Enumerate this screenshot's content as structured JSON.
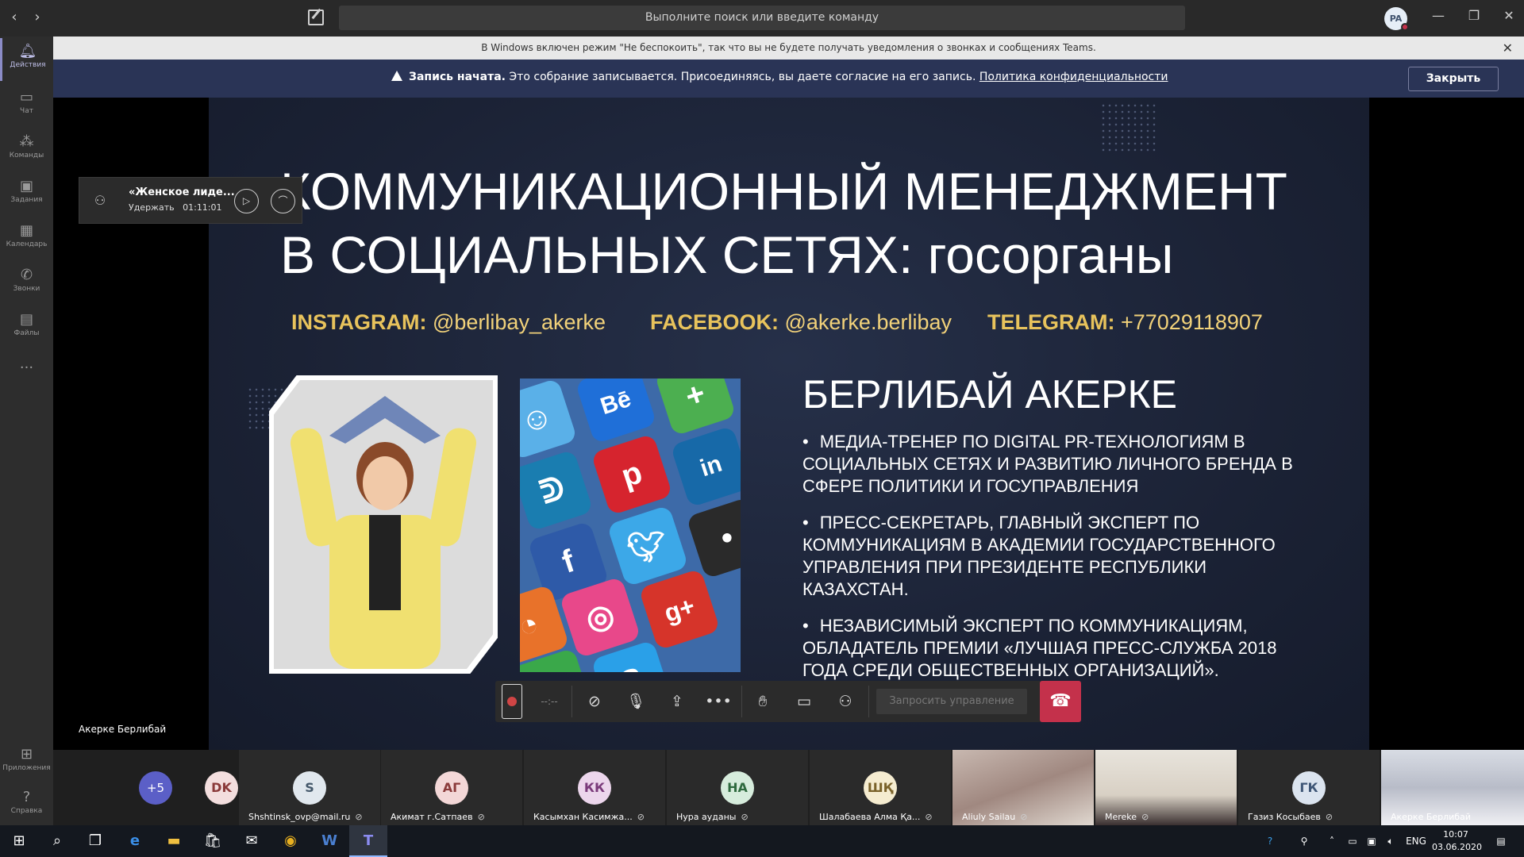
{
  "titlebar": {
    "search_placeholder": "Выполните поиск или введите команду",
    "user_initials": "PA"
  },
  "rail": {
    "items": [
      {
        "label": "Действия",
        "icon": "bell-icon"
      },
      {
        "label": "Чат",
        "icon": "chat-icon"
      },
      {
        "label": "Команды",
        "icon": "teams-icon"
      },
      {
        "label": "Задания",
        "icon": "assignments-icon"
      },
      {
        "label": "Календарь",
        "icon": "calendar-icon"
      },
      {
        "label": "Звонки",
        "icon": "phone-icon"
      },
      {
        "label": "Файлы",
        "icon": "file-icon"
      },
      {
        "label": "...",
        "icon": "more-icon"
      },
      {
        "label": "Приложения",
        "icon": "apps-icon"
      },
      {
        "label": "Справка",
        "icon": "help-icon"
      }
    ]
  },
  "notifications": {
    "dnd_text": "В Windows включен режим \"Не беспокоить\", так что вы не будете получать уведомления о звонках и сообщениях Teams.",
    "recording_bold": "Запись начата.",
    "recording_text": " Это собрание записывается. Присоединяясь, вы даете согласие на его запись. ",
    "privacy_link": "Политика конфиденциальности",
    "close_label": "Закрыть"
  },
  "held_call": {
    "title": "«Женское лиде...",
    "status": "Удержать",
    "duration": "01:11:01"
  },
  "slide": {
    "title_line1": "КОММУНИКАЦИОННЫЙ МЕНЕДЖМЕНТ",
    "title_line2": "В СОЦИАЛЬНЫХ СЕТЯХ: госорганы",
    "instagram_label": "INSTAGRAM:",
    "instagram_value": " @berlibay_akerke",
    "facebook_label": "FACEBOOK:",
    "facebook_value": " @akerke.berlibay",
    "telegram_label": "TELEGRAM:",
    "telegram_value": " +77029118907",
    "speaker_name": "БЕРЛИБАЙ АКЕРКЕ",
    "bullets": [
      "МЕДИА-ТРЕНЕР ПО DIGITAL PR-ТЕХНОЛОГИЯМ В СОЦИАЛЬНЫХ СЕТЯХ И РАЗВИТИЮ ЛИЧНОГО БРЕНДА В СФЕРЕ ПОЛИТИКИ И ГОСУПРАВЛЕНИЯ",
      "ПРЕСС-СЕКРЕТАРЬ, ГЛАВНЫЙ ЭКСПЕРТ ПО КОММУНИКАЦИЯМ В АКАДЕМИИ ГОСУДАРСТВЕННОГО УПРАВЛЕНИЯ ПРИ ПРЕЗИДЕНТЕ РЕСПУБЛИКИ КАЗАХСТАН.",
      "НЕЗАВИСИМЫЙ ЭКСПЕРТ ПО КОММУНИКАЦИЯМ, ОБЛАДАТЕЛЬ ПРЕМИИ «ЛУЧШАЯ ПРЕСС-СЛУЖБА 2018 ГОДА СРЕДИ ОБЩЕСТВЕННЫХ ОРГАНИЗАЦИЙ»."
    ]
  },
  "presenter_label": "Акерке Берлибай",
  "controls": {
    "timer": "--:--",
    "request_control": "Запросить управление"
  },
  "participants": {
    "more_count": "+5",
    "list": [
      {
        "initials": "DK",
        "name": "",
        "bg": "#f3dede",
        "fg": "#8a3a3a"
      },
      {
        "initials": "S",
        "name": "Shshtinsk_ovp@mail.ru",
        "bg": "#e1e8ee",
        "fg": "#44586a"
      },
      {
        "initials": "АГ",
        "name": "Акимат г.Сатпаев",
        "bg": "#f3d7d7",
        "fg": "#8a3a3a"
      },
      {
        "initials": "КК",
        "name": "Касымхан Касимжа...",
        "bg": "#ecd6ec",
        "fg": "#7a3a7a"
      },
      {
        "initials": "НА",
        "name": "Нура ауданы",
        "bg": "#d6ecdc",
        "fg": "#2e6a3e"
      },
      {
        "initials": "ШҚ",
        "name": "Шалабаева Алма Қа...",
        "bg": "#f5ecd0",
        "fg": "#7a622a"
      },
      {
        "initials": "",
        "name": "Aliuly Sailau",
        "bg": "",
        "fg": ""
      },
      {
        "initials": "",
        "name": "Mereke",
        "bg": "",
        "fg": ""
      },
      {
        "initials": "ГК",
        "name": "Газиз Косыбаев",
        "bg": "#dbe4ef",
        "fg": "#3e5676"
      },
      {
        "initials": "",
        "name": "Акерке Берлибай",
        "bg": "",
        "fg": ""
      }
    ]
  },
  "taskbar": {
    "lang": "ENG",
    "time": "10:07",
    "date": "03.06.2020"
  }
}
